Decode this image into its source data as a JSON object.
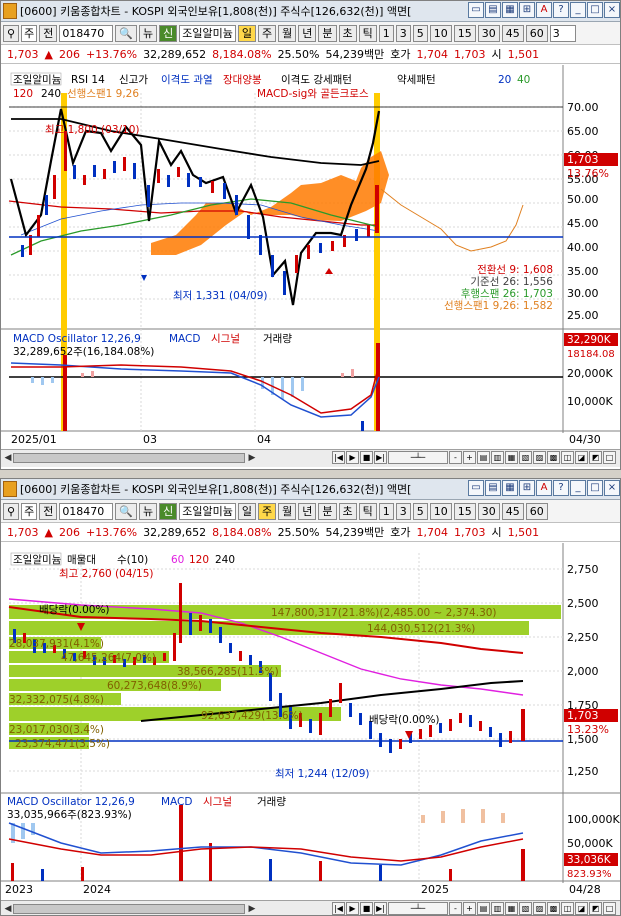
{
  "top": {
    "title": "[0600] 키움종합차트 - KOSPI 외국인보유[1,808(천)] 주식수[126,632(천)] 액면[",
    "toolbar": {
      "market": "주",
      "period_label": "전",
      "code": "018470",
      "name": "조일알미늄",
      "units": [
        "일",
        "주",
        "월",
        "년",
        "분",
        "초",
        "틱"
      ],
      "numbers": [
        "1",
        "3",
        "5",
        "10",
        "15",
        "30",
        "45",
        "60"
      ],
      "count": "3"
    },
    "quote": {
      "price": "1,703",
      "change": "206",
      "pct": "+13.76%",
      "volume": "32,289,652",
      "vol_pct": "8,184.08%",
      "turnover": "25.50%",
      "amount": "54,239백만",
      "hoga": "호가",
      "ask": "1,704",
      "bid": "1,703",
      "open_label": "시",
      "open": "1,501"
    },
    "legend1": [
      "조일알미늄",
      "RSI 14",
      "신고가",
      "이격도 과열",
      "장대양봉",
      "이격도 강세패턴",
      "약세패턴",
      "20",
      "40"
    ],
    "legend2": [
      "120",
      "240",
      "선행스팬1 9,26",
      "MACD-sig와 골든크로스"
    ],
    "high_label": "최고 1,800 (03/10)",
    "low_label": "최저 1,331 (04/09)",
    "ichimoku": [
      "전환선 9: 1,608",
      "기준선 26: 1,556",
      "후행스팬 26: 1,703",
      "선행스팬1 9,26: 1,582"
    ],
    "price_badge": "1,703",
    "price_badge_pct": "13.76%",
    "y_ticks": [
      "70.00",
      "65.00",
      "60.00",
      "55.00",
      "50.00",
      "45.00",
      "40.00",
      "35.00",
      "30.00",
      "25.00"
    ],
    "macd_legend": [
      "MACD Oscillator 12,26,9",
      "MACD",
      "시그널",
      "거래량"
    ],
    "macd_sub": "32,289,652주(16,184.08%)",
    "macd_badge": "32,290K",
    "macd_badge2": "18184.08",
    "macd_ticks": [
      "20,000K",
      "10,000K"
    ],
    "x_ticks": [
      "2025/01",
      "03",
      "04"
    ],
    "x_end": "04/30"
  },
  "bottom": {
    "title": "[0600] 키움종합차트 - KOSPI 외국인보유[1,808(천)] 주식수[126,632(천)] 액면[",
    "toolbar": {
      "market": "주",
      "period_label": "전",
      "code": "018470",
      "name": "조일알미늄",
      "units": [
        "일",
        "주",
        "월",
        "년",
        "분",
        "초",
        "틱"
      ],
      "numbers": [
        "1",
        "3",
        "5",
        "10",
        "15",
        "30",
        "45",
        "60"
      ]
    },
    "quote": {
      "price": "1,703",
      "change": "206",
      "pct": "+13.76%",
      "volume": "32,289,652",
      "vol_pct": "8,184.08%",
      "turnover": "25.50%",
      "amount": "54,239백만",
      "hoga": "호가",
      "ask": "1,704",
      "bid": "1,703",
      "open_label": "시",
      "open": "1,501"
    },
    "legend": [
      "조일알미늄",
      "매물대",
      "수(10)",
      "60",
      "120",
      "240"
    ],
    "high_label": "최고 2,760 (04/15)",
    "low_label": "최저 1,244 (12/09)",
    "dividend1": "배당락(0.00%)",
    "dividend2": "배당락(0.00%)",
    "profile_labels": [
      "147,800,317(21.8%)(2,485.00 ~ 2,374.30)",
      "144,030,512(21.3%)",
      "28,037,931(4.1%)",
      "47,645,264(7.0%)",
      "38,566,285(11.5%)",
      "60,273,648(8.9%)",
      "32,332,075(4.8%)",
      "92,637,429(13.6%)",
      "23,017,030(3.4%)",
      "23,374,471(3.5%)"
    ],
    "price_badge": "1,703",
    "price_badge_pct": "13.23%",
    "y_ticks": [
      "2,750",
      "2,500",
      "2,250",
      "2,000",
      "1,750",
      "1,500",
      "1,250"
    ],
    "macd_legend": [
      "MACD Oscillator 12,26,9",
      "MACD",
      "시그널",
      "거래량"
    ],
    "macd_sub": "33,035,966주(823.93%)",
    "macd_ticks": [
      "100,000K",
      "50,000K"
    ],
    "macd_badge": "33,036K",
    "macd_badge2": "823.93%",
    "x_ticks": [
      "2023",
      "2024",
      "2025"
    ],
    "x_end": "04/28"
  },
  "colors": {
    "up": "#d00000",
    "down": "#0030c0",
    "ichimoku_cloud": "#ff7a00",
    "profile_bar": "#9ed02a",
    "line_black": "#000000",
    "ma_red": "#d00000",
    "ma_green": "#2a9a2a",
    "ma_magenta": "#e020e0",
    "highlight": "#ffcc00"
  }
}
